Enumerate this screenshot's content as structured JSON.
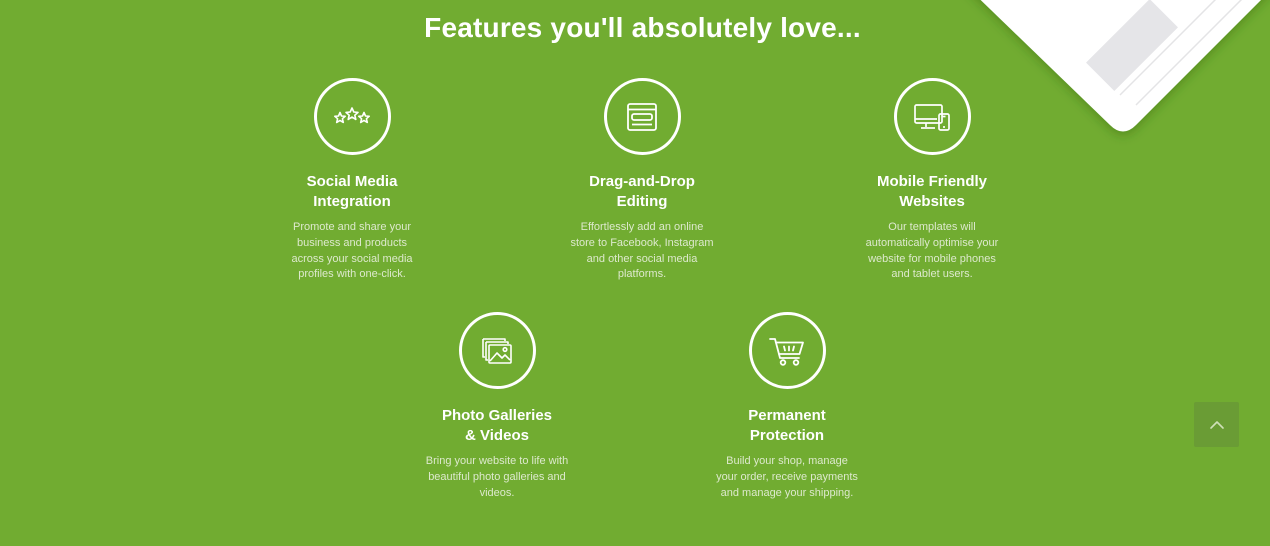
{
  "title": "Features you'll absolutely love...",
  "features": [
    {
      "icon": "stars-icon",
      "title": "Social Media Integration",
      "desc": "Promote and share your business and products across your social media profiles with one-click."
    },
    {
      "icon": "browser-window-icon",
      "title": "Drag-and-Drop Editing",
      "desc": "Effortlessly add an online store to Facebook, Instagram and other social media platforms."
    },
    {
      "icon": "devices-icon",
      "title": "Mobile Friendly Websites",
      "desc": "Our templates will automatically optimise your website for mobile phones and tablet users."
    },
    {
      "icon": "photo-gallery-icon",
      "title": "Photo Galleries & Videos",
      "desc": "Bring your website to life with beautiful photo galleries and videos."
    },
    {
      "icon": "shopping-cart-icon",
      "title": "Permanent Protection",
      "desc": "Build your shop, manage your order, receive payments and manage your shipping."
    }
  ],
  "scroll_top": {
    "icon": "chevron-up-icon"
  },
  "colors": {
    "background": "#71ac31",
    "text": "#ffffff",
    "description": "#dde9cd",
    "scroll_button": "#6a9c35"
  }
}
